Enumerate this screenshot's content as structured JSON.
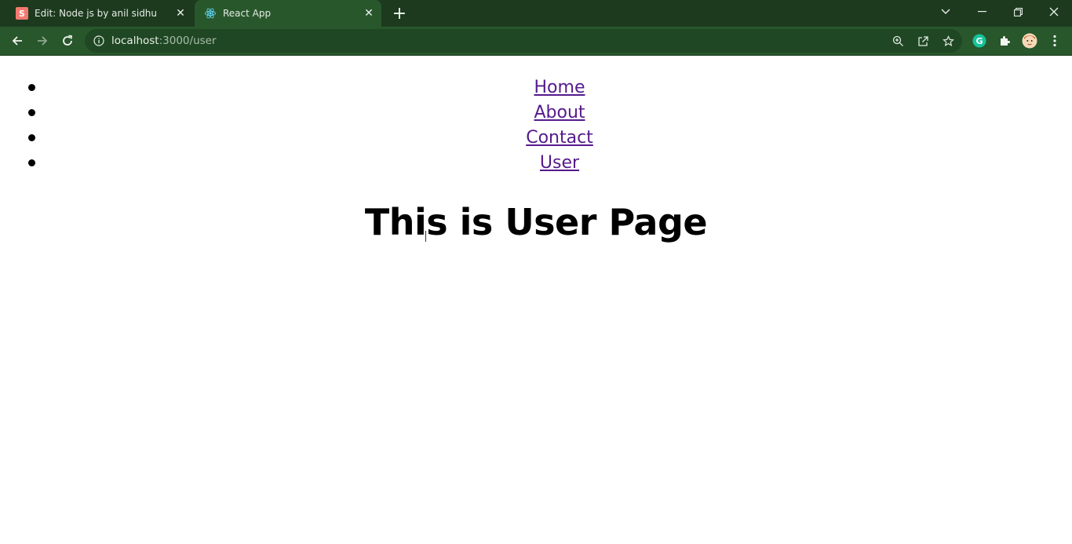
{
  "browser": {
    "tabs": [
      {
        "title": "Edit: Node js by anil sidhu",
        "favicon": "S",
        "favicon_color": "#f4796f",
        "active": false
      },
      {
        "title": "React App",
        "favicon": "react-icon",
        "active": true
      }
    ],
    "new_tab_icon": "plus-icon",
    "window_controls": [
      "chevron-down-icon",
      "minimize-icon",
      "restore-icon",
      "close-icon"
    ],
    "address": {
      "host": "localhost",
      "path": ":3000/user"
    },
    "toolbar_icons": [
      "back-icon",
      "forward-icon",
      "reload-icon",
      "info-icon",
      "zoom-icon",
      "share-icon",
      "star-icon",
      "grammarly-icon",
      "extensions-icon",
      "profile-avatar-icon",
      "menu-icon"
    ],
    "colors": {
      "tabbar": "#1d3a1f",
      "active_tab": "#28572c",
      "omnibox": "#204724"
    }
  },
  "page": {
    "nav": [
      {
        "label": "Home"
      },
      {
        "label": "About"
      },
      {
        "label": "Contact"
      },
      {
        "label": "User"
      }
    ],
    "heading": "This is User Page",
    "link_color": "#551a8b"
  }
}
